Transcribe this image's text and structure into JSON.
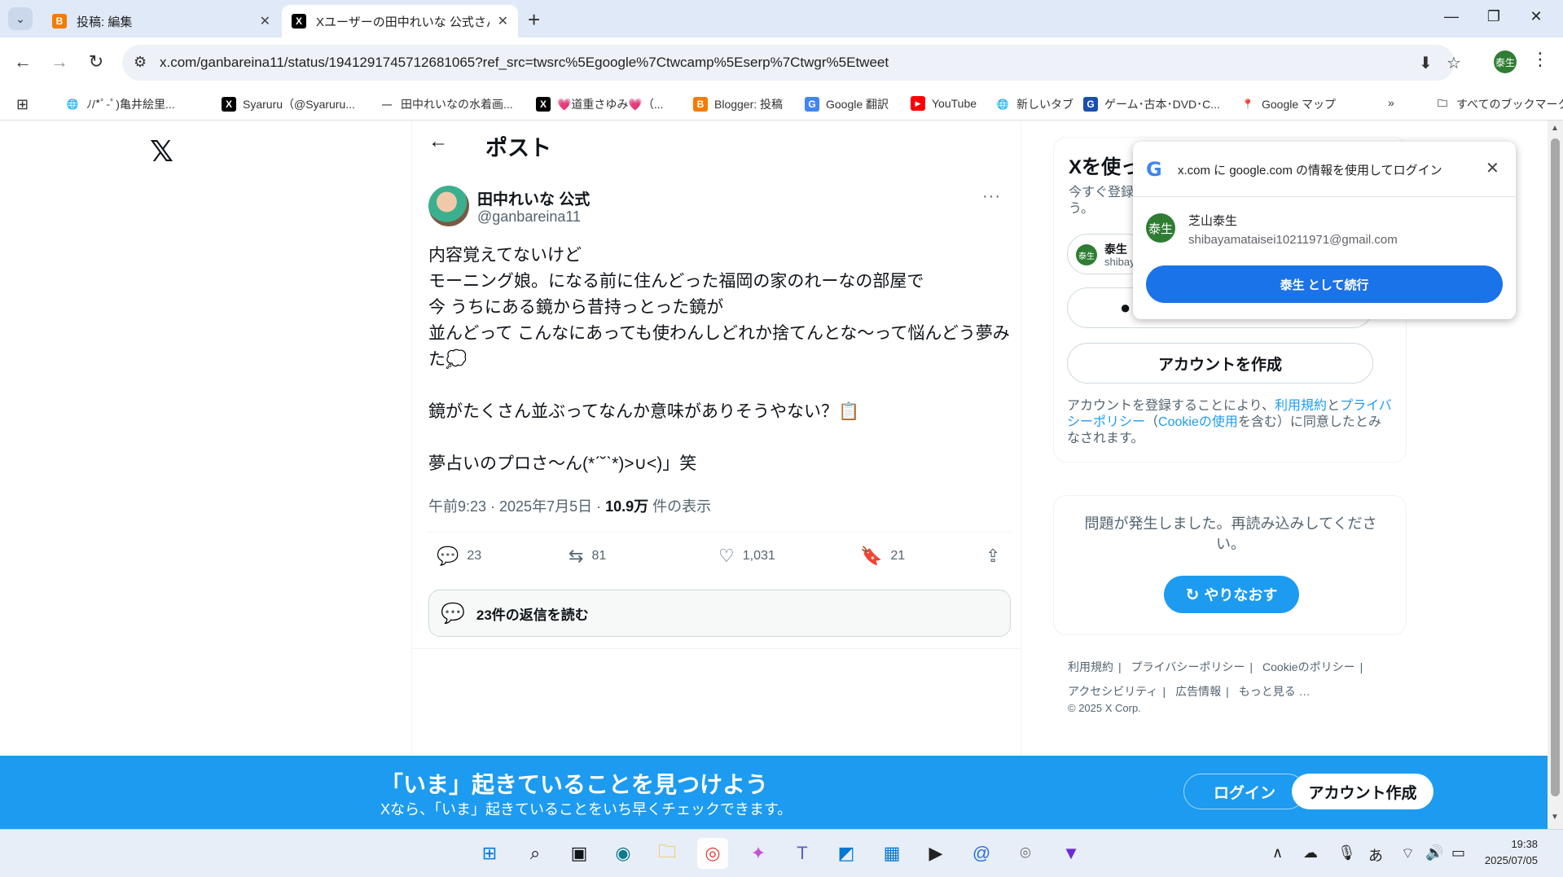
{
  "browser": {
    "tabs": [
      {
        "title": "投稿: 編集",
        "icon": "blogger-icon"
      },
      {
        "title": "Xユーザーの田中れいな 公式さん: 「内容覚えてないけど",
        "icon": "x-icon"
      }
    ],
    "url": "x.com/ganbareina11/status/1941291745712681065?ref_src=twsrc%5Egoogle%7Ctwcamp%5Eserp%7Ctwgr%5Etweet",
    "profile_initial": "泰生",
    "bookmarks": [
      {
        "label": "ﾉ/*ﾟ-ﾟ)亀井絵里...",
        "icon": "globe-icon"
      },
      {
        "label": "Syaruru（@Syaruru...",
        "icon": "x-icon"
      },
      {
        "label": "田中れいなの水着画...",
        "icon": "dash-icon"
      },
      {
        "label": "💗道重さゆみ💗（...",
        "icon": "x-icon"
      },
      {
        "label": "Blogger: 投稿",
        "icon": "blogger-icon"
      },
      {
        "label": "Google 翻訳",
        "icon": "translate-icon"
      },
      {
        "label": "YouTube",
        "icon": "youtube-icon"
      },
      {
        "label": "新しいタブ",
        "icon": "globe-icon"
      },
      {
        "label": "ゲーム･古本･DVD･C...",
        "icon": "shop-icon"
      },
      {
        "label": "Google マップ",
        "icon": "maps-icon"
      }
    ],
    "all_bookmarks": "すべてのブックマーク",
    "more_bookmarks": "»"
  },
  "post": {
    "header": "ポスト",
    "author_name": "田中れいな 公式",
    "author_handle": "@ganbareina11",
    "text": "内容覚えてないけど\nモーニング娘。になる前に住んどった福岡の家のれーなの部屋で\n今 うちにある鏡から昔持っとった鏡が\n並んどって こんなにあっても使わんしどれか捨てんとな〜って悩んどう夢みた💭\n\n鏡がたくさん並ぶってなんか意味がありそうやない？📋\n\n夢占いのプロさ〜ん(*ˊ˘ˋ*)>∪<)」笑",
    "meta_time": "午前9:23 · 2025年7月5日 · ",
    "meta_views": "10.9万",
    "meta_views_suffix": " 件の表示",
    "replies": "23",
    "reposts": "81",
    "likes": "1,031",
    "bookmarks": "21",
    "read_replies": "23件の返信を読む"
  },
  "sidebar": {
    "title": "Xを使っ",
    "subtitle": "今すぐ登録よう。",
    "pill_name": "泰生",
    "pill_email": "shibay",
    "create_account": "アカウントを作成",
    "terms_prefix": "アカウントを登録することにより、",
    "terms_link": "利用規約",
    "terms_and": "と",
    "privacy_link": "プライバシーポリシー",
    "cookie_prefix": "（",
    "cookie_link": "Cookieの使用",
    "terms_suffix": "を含む）に同意したとみなされます。",
    "error_text": "問題が発生しました。再読み込みしてください。",
    "retry": "やりなおす",
    "footer": [
      "利用規約",
      "プライバシーポリシー",
      "Cookieのポリシー",
      "アクセシビリティ",
      "広告情報",
      "もっと見る …"
    ],
    "copyright": "© 2025 X Corp."
  },
  "google_popup": {
    "title": "x.com に google.com の情報を使用してログイン",
    "name": "芝山泰生",
    "email": "shibayamataisei10211971@gmail.com",
    "avatar": "泰生",
    "continue": "泰生 として続行"
  },
  "banner": {
    "title": "「いま」起きていることを見つけよう",
    "subtitle": "Xなら、「いま」起きていることをいち早くチェックできます。",
    "login": "ログイン",
    "signup": "アカウント作成"
  },
  "taskbar": {
    "time": "19:38",
    "date": "2025/07/05",
    "ime": "あ"
  }
}
